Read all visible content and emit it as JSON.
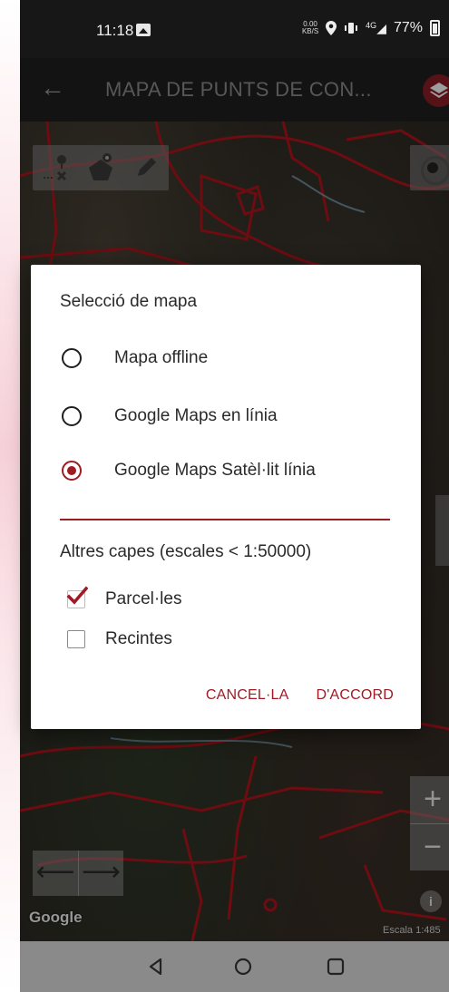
{
  "status_bar": {
    "time": "11:18",
    "speed_value": "0.00",
    "speed_unit": "KB/S",
    "network": "4G",
    "battery": "77%"
  },
  "toolbar": {
    "title": "MAPA DE PUNTS DE CON..."
  },
  "map": {
    "attribution": "Google",
    "scale": "Escala 1:485",
    "zoom_in": "+",
    "zoom_out": "−",
    "info": "i"
  },
  "dialog": {
    "title": "Selecció de mapa",
    "map_options": [
      {
        "label": "Mapa offline",
        "selected": false
      },
      {
        "label": "Google Maps en línia",
        "selected": false
      },
      {
        "label": "Google Maps Satèl·lit línia",
        "selected": true
      }
    ],
    "layers_heading": "Altres capes (escales < 1:50000)",
    "layers": [
      {
        "label": "Parcel·les",
        "checked": true
      },
      {
        "label": "Recintes",
        "checked": false
      }
    ],
    "cancel": "CANCEL·LA",
    "ok": "D'ACCORD"
  },
  "colors": {
    "accent": "#9e1b23",
    "map_lines": "#b0141c"
  },
  "icons": [
    "back-arrow-icon",
    "layers-icon",
    "delete-point-icon",
    "polygon-icon",
    "pencil-icon",
    "target-icon",
    "arrow-left-icon",
    "arrow-right-icon",
    "back-triangle-icon",
    "home-circle-icon",
    "recents-square-icon"
  ]
}
